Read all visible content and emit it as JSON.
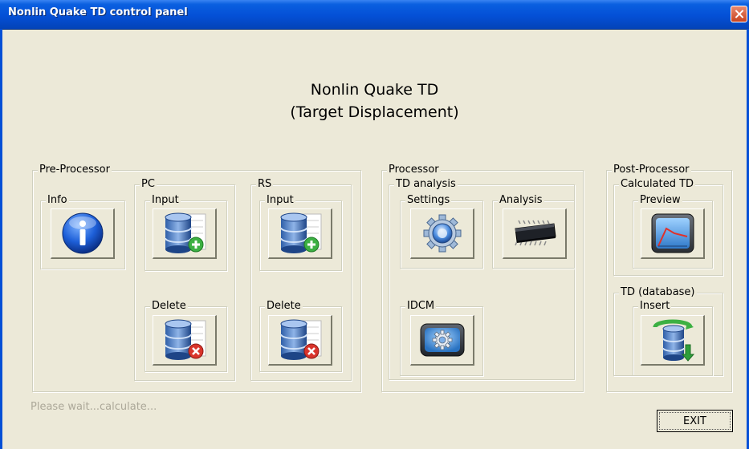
{
  "window": {
    "title": "Nonlin Quake TD control panel"
  },
  "header": {
    "line1": "Nonlin Quake TD",
    "line2": "(Target Displacement)"
  },
  "pre_processor": {
    "legend": "Pre-Processor",
    "info": {
      "legend": "Info",
      "icon": "info-icon"
    },
    "pc": {
      "legend": "PC",
      "input": {
        "legend": "Input",
        "icon": "database-add-icon"
      },
      "delete": {
        "legend": "Delete",
        "icon": "database-delete-icon"
      }
    },
    "rs": {
      "legend": "RS",
      "input": {
        "legend": "Input",
        "icon": "database-add-icon"
      },
      "delete": {
        "legend": "Delete",
        "icon": "database-delete-icon"
      }
    }
  },
  "processor": {
    "legend": "Processor",
    "td_analysis": {
      "legend": "TD analysis",
      "settings": {
        "legend": "Settings",
        "icon": "gear-icon"
      },
      "analysis": {
        "legend": "Analysis",
        "icon": "chip-icon"
      },
      "idcm": {
        "legend": "IDCM",
        "icon": "gear-panel-icon"
      }
    }
  },
  "post_processor": {
    "legend": "Post-Processor",
    "calculated_td": {
      "legend": "Calculated TD",
      "preview": {
        "legend": "Preview",
        "icon": "chart-preview-icon"
      }
    },
    "td_database": {
      "legend": "TD (database)",
      "insert": {
        "legend": "Insert",
        "icon": "database-insert-icon"
      }
    }
  },
  "status": "Please wait...calculate...",
  "exit_label": "EXIT",
  "colors": {
    "titlebar": "#0450d6",
    "face": "#ece9d8",
    "status_text": "#aca899"
  }
}
